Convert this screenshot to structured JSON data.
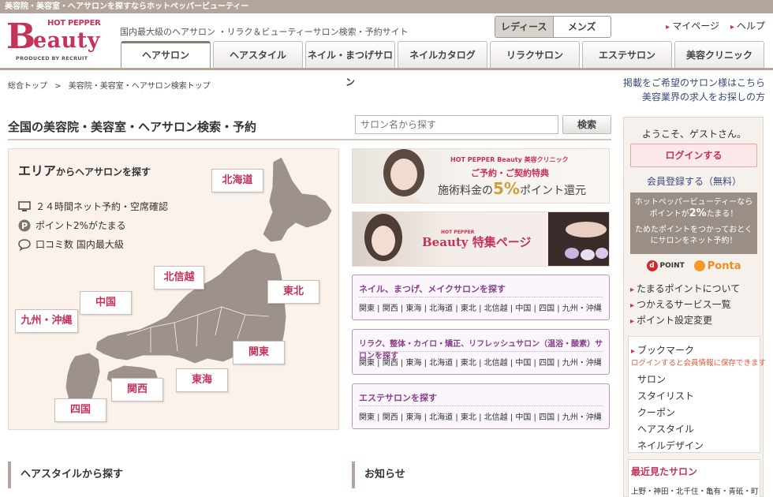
{
  "topstrip": "美容院・美容室・ヘアサロンを探すならホットペッパービューティー",
  "logo": {
    "top": "HOT PEPPER",
    "b": "B",
    "rest": "eauty",
    "produced": "PRODUCED BY RECRUIT"
  },
  "tagline": "国内最大級のヘアサロン ・リラク＆ビューティーサロン検索・予約サイト",
  "gender": {
    "ladies": "レディース",
    "mens": "メンズ"
  },
  "toplinks": {
    "mypage": "マイページ",
    "help": "ヘルプ"
  },
  "tabs": [
    "ヘアサロン",
    "ヘアスタイル",
    "ネイル・まつげサロン",
    "ネイルカタログ",
    "リラクサロン",
    "エステサロン",
    "美容クリニック"
  ],
  "breadcrumb": {
    "home": "総合トップ",
    "sep": ">",
    "current": "美容院・美容室・ヘアサロン検索トップ"
  },
  "rightlinks": {
    "salon": "掲載をご希望のサロン様はこちら",
    "jobs": "美容業界の求人をお探しの方"
  },
  "page_title": "全国の美容院・美容室・ヘアサロン検索・予約",
  "search": {
    "placeholder": "サロン名から探す",
    "button": "検索"
  },
  "map": {
    "heading_bold": "エリア",
    "heading_rest": "からヘアサロンを探す",
    "features": [
      "２４時間ネット予約・空席確認",
      "ポイント2%がたまる",
      "口コミ数 国内最大級"
    ],
    "regions": {
      "hokkaido": "北海道",
      "tohoku": "東北",
      "hokushinetsu": "北信越",
      "kanto": "関東",
      "tokai": "東海",
      "kansai": "関西",
      "chugoku": "中国",
      "shikoku": "四国",
      "kyushu": "九州・沖縄"
    }
  },
  "banner1": {
    "brand": "HOT PEPPER Beauty 美容クリニック",
    "line1": "ご予約・ご契約特典",
    "line2a": "施術料金の",
    "line2b": "5%",
    "line2c": "ポイント還元"
  },
  "banner2": {
    "brand_small": "HOT PEPPER",
    "brand": "Beauty",
    "text": "特集ページ"
  },
  "categories": [
    {
      "title": "ネイル、まつげ、メイクサロンを探す",
      "links": "関東 | 関西 | 東海 | 北海道 | 東北 | 北信越 | 中国 | 四国 | 九州・沖縄"
    },
    {
      "title": "リラク、整体・カイロ・矯正、リフレッシュサロン（温浴・酸素）サロンを探す",
      "links": "関東 | 関西 | 東海 | 北海道 | 東北 | 北信越 | 中国 | 四国 | 九州・沖縄"
    },
    {
      "title": "エステサロンを探す",
      "links": "関東 | 関西 | 東海 | 北海道 | 東北 | 北信越 | 中国 | 四国 | 九州・沖縄"
    }
  ],
  "sections": {
    "hairstyle": "ヘアスタイルから探す",
    "news": "お知らせ"
  },
  "sidebar": {
    "welcome": "ようこそ、ゲストさん。",
    "login": "ログインする",
    "register": "会員登録する（無料）",
    "point_l1": "ホットペッパービューティーなら",
    "point_l2a": "ポイントが",
    "point_l2b": "2%",
    "point_l2c": "たまる！",
    "point_l3": "ためたポイントをつかっておとくにサロンをネット予約！",
    "dpoint": "POINT",
    "ponta": "Ponta",
    "links": [
      "たまるポイントについて",
      "つかえるサービス一覧",
      "ポイント設定変更"
    ],
    "bookmark": "ブックマーク",
    "bookmark_note": "ログインすると会員情報に保存できます",
    "bookmark_items": [
      "サロン",
      "スタイリスト",
      "クーポン",
      "ヘアスタイル",
      "ネイルデザイン"
    ],
    "recent_title": "最近見たサロン",
    "recent_item": "上野・神田・北千住・亀有・青砥・町"
  }
}
